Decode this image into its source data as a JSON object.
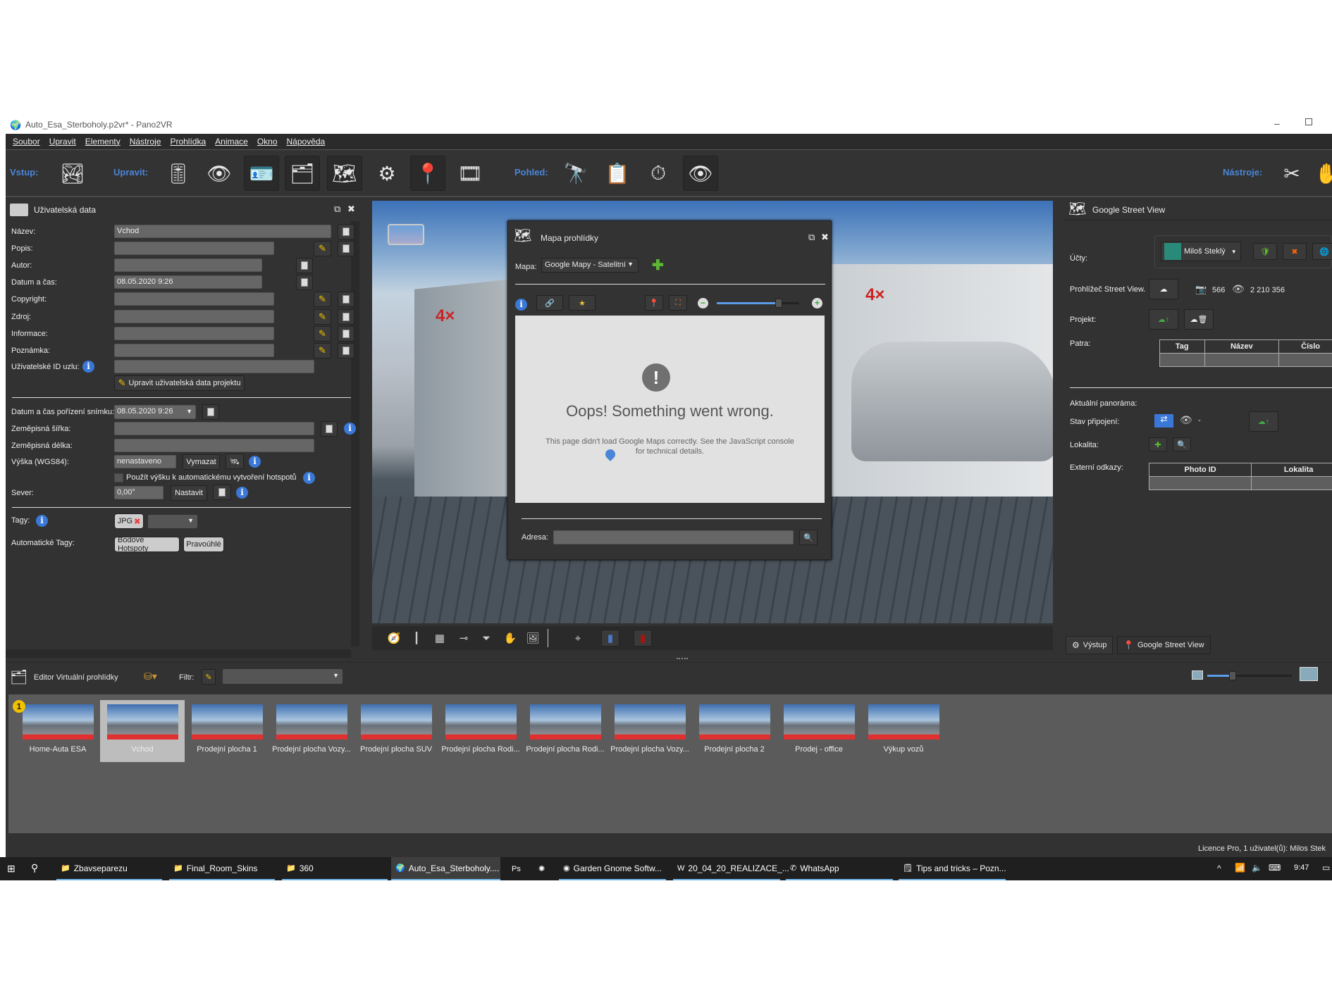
{
  "window": {
    "title": "Auto_Esa_Sterboholy.p2vr* - Pano2VR"
  },
  "menu": [
    "Soubor",
    "Upravit",
    "Elementy",
    "Nástroje",
    "Prohlídka",
    "Animace",
    "Okno",
    "Nápověda"
  ],
  "toolbar": {
    "input_label": "Vstup:",
    "edit_label": "Upravit:",
    "view_label": "Pohled:",
    "tools_label": "Nástroje:",
    "icons": {
      "input": [
        "add-panorama-icon"
      ],
      "edit": [
        "sliders-icon",
        "viewing-parameters-icon",
        "user-data-icon",
        "tour-browser-icon",
        "tour-map-icon",
        "output-grinder-icon",
        "google-street-view-icon",
        "animation-film-icon"
      ],
      "view": [
        "binoculars-icon",
        "clipboard-icon",
        "stopwatch-icon",
        "eye-icon"
      ],
      "tools": [
        "skin-editor-icon",
        "hand-icon"
      ]
    }
  },
  "user_data": {
    "title": "Uživatelská data",
    "fields": [
      {
        "label": "Název:",
        "value": "Vchod"
      },
      {
        "label": "Popis:",
        "value": ""
      },
      {
        "label": "Autor:",
        "value": ""
      },
      {
        "label": "Datum a čas:",
        "value": "08.05.2020 9:26"
      },
      {
        "label": "Copyright:",
        "value": ""
      },
      {
        "label": "Zdroj:",
        "value": ""
      },
      {
        "label": "Informace:",
        "value": ""
      },
      {
        "label": "Poznámka:",
        "value": ""
      },
      {
        "label": "Uživatelské ID uzlu:",
        "value": ""
      }
    ],
    "edit_project_button": "Upravit uživatelská data projektu",
    "capture_label": "Datum a čas pořízení snímku:",
    "capture_value": "08.05.2020 9:26",
    "lat_label": "Zeměpisná šířka:",
    "lat_value": "",
    "lon_label": "Zeměpisná délka:",
    "lon_value": "",
    "alt_label": "Výška (WGS84):",
    "alt_value": "nenastaveno",
    "clear_button": "Vymazat",
    "use_alt_checkbox": "Použít výšku k automatickému vytvoření hotspotů",
    "use_alt_checked": false,
    "north_label": "Sever:",
    "north_value": "0,00°",
    "set_button": "Nastavit",
    "tags_label": "Tagy:",
    "tags": [
      "JPG"
    ],
    "auto_tags_label": "Automatické Tagy:",
    "auto_tags": [
      "Bodové Hotspoty",
      "Pravoúhlé"
    ]
  },
  "map_dialog": {
    "title": "Mapa prohlídky",
    "map_label": "Mapa:",
    "map_value": "Google Mapy - Satelitní",
    "zoom_level": 0.75,
    "error_title": "Oops! Something went wrong.",
    "error_text": "This page didn't load Google Maps correctly. See the JavaScript console for technical details.",
    "address_label": "Adresa:",
    "address_value": ""
  },
  "street_view": {
    "title": "Google Street View",
    "accounts_label": "Účty:",
    "account_name": "Miloš Steklý",
    "viewer_label": "Prohlížeč Street View.",
    "photos_count": "566",
    "views_count": "2 210 356",
    "project_label": "Projekt:",
    "levels_label": "Patra:",
    "levels_columns": [
      "Tag",
      "Název",
      "Číslo"
    ],
    "current_label": "Aktuální panoráma:",
    "connection_label": "Stav připojení:",
    "connection_views": "-",
    "location_label": "Lokalita:",
    "external_label": "Externí odkazy:",
    "external_columns": [
      "Photo ID",
      "Lokalita"
    ],
    "tabs": [
      "Výstup",
      "Google Street View"
    ],
    "active_tab": "Google Street View"
  },
  "tour_editor": {
    "title": "Editor Virtuální prohlídky",
    "filter_label": "Filtr:",
    "filter_value": "",
    "thumb_size": 0.3,
    "start_badge": "1",
    "nodes": [
      "Home-Auta ESA",
      "Vchod",
      "Prodejní plocha 1",
      "Prodejní plocha Vozy...",
      "Prodejní plocha SUV",
      "Prodejní plocha Rodi...",
      "Prodejní plocha Rodi...",
      "Prodejní plocha Vozy...",
      "Prodejní plocha 2",
      "Prodej - office",
      "Výkup vozů"
    ],
    "selected": "Vchod"
  },
  "status": {
    "license": "Licence Pro, 1 uživatel(ů): Milos Stek"
  },
  "taskbar": {
    "items": [
      {
        "label": "Zbavseparezu",
        "icon": "folder-icon"
      },
      {
        "label": "Final_Room_Skins",
        "icon": "folder-icon"
      },
      {
        "label": "360",
        "icon": "folder-icon"
      },
      {
        "label": "Auto_Esa_Sterboholy....",
        "icon": "pano2vr-icon",
        "active": true
      },
      {
        "label": "",
        "icon": "photoshop-icon"
      },
      {
        "label": "",
        "icon": "app-icon"
      },
      {
        "label": "Garden Gnome Softw...",
        "icon": "chrome-icon"
      },
      {
        "label": "20_04_20_REALIZACE_...",
        "icon": "word-icon"
      },
      {
        "label": "WhatsApp",
        "icon": "whatsapp-icon"
      },
      {
        "label": "Tips and tricks – Pozn...",
        "icon": "notepad-icon"
      }
    ],
    "clock": "9:47"
  }
}
